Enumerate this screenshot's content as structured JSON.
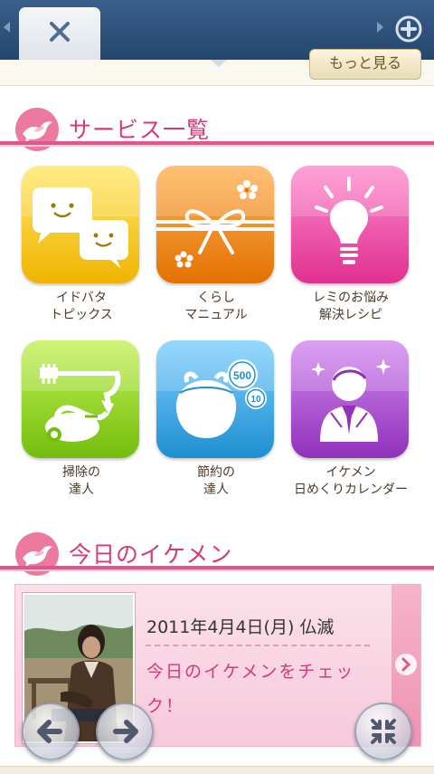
{
  "browser": {
    "tab_close_icon": "close-icon",
    "new_tab_icon": "plus-circle-icon"
  },
  "more_button": {
    "label": "もっと見る"
  },
  "services": {
    "title": "サービス一覧",
    "items": [
      {
        "label_line1": "イドバタ",
        "label_line2": "トピックス",
        "icon": "chat-bubbles-icon",
        "color": "#f3c200"
      },
      {
        "label_line1": "くらし",
        "label_line2": "マニュアル",
        "icon": "gift-ribbon-icon",
        "color": "#f08a1c"
      },
      {
        "label_line1": "レミのお悩み",
        "label_line2": "解決レシピ",
        "icon": "light-bulb-icon",
        "color": "#ee4fa8"
      },
      {
        "label_line1": "掃除の",
        "label_line2": "達人",
        "icon": "vacuum-cleaner-icon",
        "color": "#8fd11c"
      },
      {
        "label_line1": "節約の",
        "label_line2": "達人",
        "icon": "coin-purse-icon",
        "color": "#35a9e4"
      },
      {
        "label_line1": "イケメン",
        "label_line2": "日めくりカレンダー",
        "icon": "ikemen-suit-icon",
        "color": "#a54fc9"
      }
    ],
    "purse_coins": [
      "500",
      "10"
    ]
  },
  "ikemen": {
    "title": "今日のイケメン",
    "date": "2011年4月4日(月) 仏滅",
    "link_text": "今日のイケメンをチェック！"
  },
  "controls": {
    "back_icon": "arrow-left-icon",
    "forward_icon": "arrow-right-icon",
    "shrink_icon": "collapse-icon"
  },
  "colors": {
    "accent_pink": "#d23a78",
    "tabbar_blue": "#2f5380"
  }
}
